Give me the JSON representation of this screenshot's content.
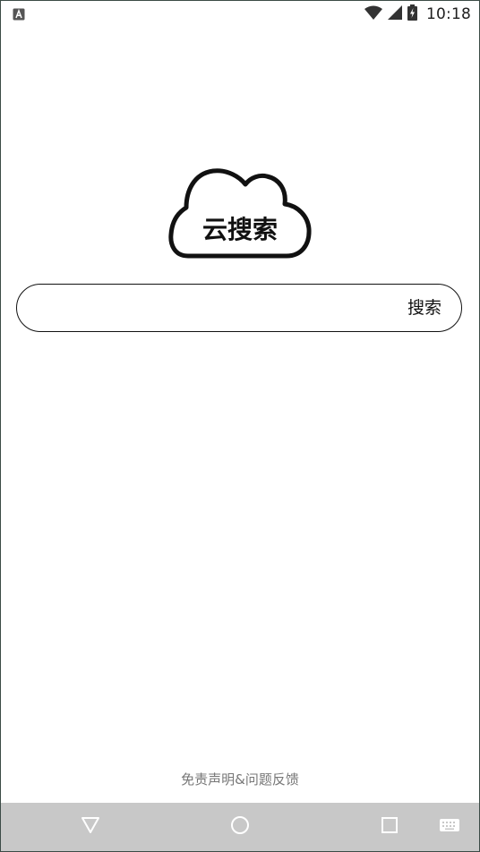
{
  "status_bar": {
    "time": "10:18",
    "icons": [
      "notification-a-icon",
      "wifi-icon",
      "cell-signal-icon",
      "battery-charging-icon"
    ]
  },
  "logo": {
    "text": "云搜索"
  },
  "search": {
    "value": "",
    "placeholder": "",
    "button_label": "搜索"
  },
  "footer": {
    "link_label": "免责声明&问题反馈"
  },
  "nav_bar": {
    "buttons": [
      "back-icon",
      "home-icon",
      "recents-icon",
      "keyboard-icon"
    ],
    "background": "#c8c8c8"
  }
}
